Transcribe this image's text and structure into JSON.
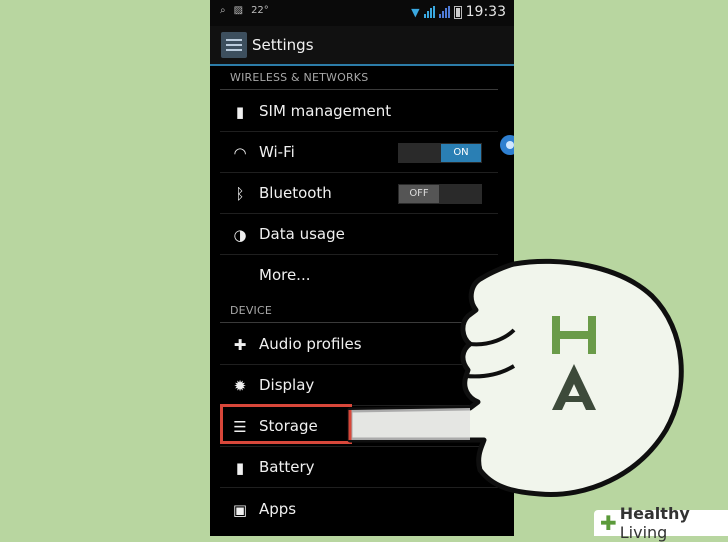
{
  "status_bar": {
    "temp": "22°",
    "time": "19:33"
  },
  "action_bar": {
    "title": "Settings"
  },
  "sections": {
    "wireless": "WIRELESS & NETWORKS",
    "device": "DEVICE"
  },
  "items": [
    {
      "label": "SIM management",
      "icon": "sim-icon"
    },
    {
      "label": "Wi-Fi",
      "icon": "wifi-icon",
      "toggle": "ON"
    },
    {
      "label": "Bluetooth",
      "icon": "bluetooth-icon",
      "toggle": "OFF"
    },
    {
      "label": "Data usage",
      "icon": "data-usage-icon"
    },
    {
      "label": "More...",
      "icon": ""
    },
    {
      "label": "Audio profiles",
      "icon": "audio-profiles-icon"
    },
    {
      "label": "Display",
      "icon": "display-icon"
    },
    {
      "label": "Storage",
      "icon": "storage-icon"
    },
    {
      "label": "Battery",
      "icon": "battery-icon"
    },
    {
      "label": "Apps",
      "icon": "apps-icon"
    }
  ],
  "watermark": {
    "plus": "✚",
    "brand_bold": "Healthy",
    "brand_rest": " Living"
  },
  "colors": {
    "accent": "#2a7fb4",
    "highlight": "#d7473a",
    "background": "#b8d6a0"
  }
}
